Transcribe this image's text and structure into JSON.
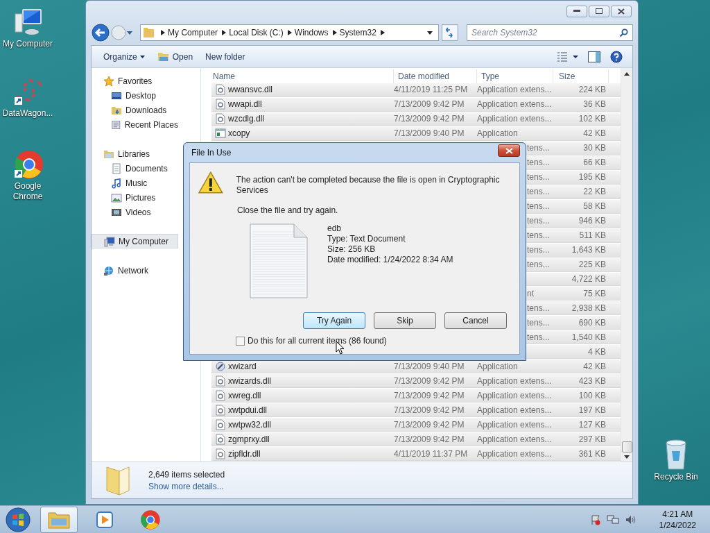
{
  "desktop_icons": [
    {
      "label": "My Computer",
      "kind": "computer"
    },
    {
      "label": "DataWagon...",
      "kind": "dots"
    },
    {
      "label": "Google Chrome",
      "kind": "chrome"
    },
    {
      "label": "Recycle Bin",
      "kind": "bin"
    }
  ],
  "explorer": {
    "address": [
      "My Computer",
      "Local Disk (C:)",
      "Windows",
      "System32"
    ],
    "search": {
      "placeholder": "Search System32"
    },
    "toolbar": [
      {
        "label": "Organize",
        "kind": "menu"
      },
      {
        "label": "Open",
        "kind": "open"
      },
      {
        "label": "New folder",
        "kind": "plain"
      }
    ],
    "nav": [
      {
        "label": "Favorites",
        "kind": "favorites",
        "selected": false,
        "children": [
          {
            "label": "Desktop",
            "kind": "desktop",
            "selected": false
          },
          {
            "label": "Downloads",
            "kind": "downloads",
            "selected": false
          },
          {
            "label": "Recent Places",
            "kind": "recent",
            "selected": false
          }
        ]
      },
      {
        "label": "Libraries",
        "kind": "libraries",
        "selected": false,
        "children": [
          {
            "label": "Documents",
            "kind": "documents",
            "selected": false
          },
          {
            "label": "Music",
            "kind": "music",
            "selected": false
          },
          {
            "label": "Pictures",
            "kind": "pictures",
            "selected": false
          },
          {
            "label": "Videos",
            "kind": "videos",
            "selected": false
          }
        ]
      },
      {
        "label": "My Computer",
        "kind": "computer",
        "selected": true
      },
      {
        "label": "Network",
        "kind": "network",
        "selected": false
      }
    ],
    "columns": [
      "Name",
      "Date modified",
      "Type",
      "Size"
    ],
    "rows": [
      {
        "kind": "dll",
        "name": "wwansvc.dll",
        "date": "4/11/2019 11:25 PM",
        "type": "Application extens...",
        "size": "224 KB",
        "selected": true
      },
      {
        "kind": "dll",
        "name": "wwapi.dll",
        "date": "7/13/2009 9:42 PM",
        "type": "Application extens...",
        "size": "36 KB",
        "selected": true
      },
      {
        "kind": "dll",
        "name": "wzcdlg.dll",
        "date": "7/13/2009 9:42 PM",
        "type": "Application extens...",
        "size": "102 KB",
        "selected": true
      },
      {
        "kind": "exe",
        "name": "xcopy",
        "date": "7/13/2009 9:40 PM",
        "type": "Application",
        "size": "42 KB",
        "selected": true
      },
      {
        "kind": "partial",
        "type": "tens...",
        "size": "30 KB",
        "selected": true
      },
      {
        "kind": "partial",
        "type": "tens...",
        "size": "66 KB",
        "selected": true
      },
      {
        "kind": "partial",
        "type": "tens...",
        "size": "195 KB",
        "selected": true
      },
      {
        "kind": "partial",
        "type": "tens...",
        "size": "22 KB",
        "selected": true
      },
      {
        "kind": "partial",
        "type": "tens...",
        "size": "58 KB",
        "selected": true
      },
      {
        "kind": "partial",
        "type": "tens...",
        "size": "946 KB",
        "selected": true
      },
      {
        "kind": "partial",
        "type": "tens...",
        "size": "511 KB",
        "selected": true
      },
      {
        "kind": "partial",
        "type": "tens...",
        "size": "1,643 KB",
        "selected": true
      },
      {
        "kind": "partial",
        "type": "tens...",
        "size": "225 KB",
        "selected": true
      },
      {
        "kind": "partial",
        "size": "4,722 KB",
        "selected": true
      },
      {
        "kind": "partial",
        "type": "nt",
        "size": "75 KB",
        "selected": true
      },
      {
        "kind": "partial",
        "type": "tens...",
        "size": "2,938 KB",
        "selected": true
      },
      {
        "kind": "partial",
        "type": "tens...",
        "size": "690 KB",
        "selected": true
      },
      {
        "kind": "partial",
        "type": "tens...",
        "size": "1,540 KB",
        "selected": true
      },
      {
        "kind": "partial",
        "size": "4 KB",
        "selected": true
      },
      {
        "kind": "wizard",
        "name": "xwizard",
        "date": "7/13/2009 9:40 PM",
        "type": "Application",
        "size": "42 KB",
        "selected": true
      },
      {
        "kind": "dll",
        "name": "xwizards.dll",
        "date": "7/13/2009 9:42 PM",
        "type": "Application extens...",
        "size": "423 KB",
        "selected": true
      },
      {
        "kind": "dll",
        "name": "xwreg.dll",
        "date": "7/13/2009 9:42 PM",
        "type": "Application extens...",
        "size": "100 KB",
        "selected": true
      },
      {
        "kind": "dll",
        "name": "xwtpdui.dll",
        "date": "7/13/2009 9:42 PM",
        "type": "Application extens...",
        "size": "197 KB",
        "selected": true
      },
      {
        "kind": "dll",
        "name": "xwtpw32.dll",
        "date": "7/13/2009 9:42 PM",
        "type": "Application extens...",
        "size": "127 KB",
        "selected": true
      },
      {
        "kind": "dll",
        "name": "zgmprxy.dll",
        "date": "7/13/2009 9:42 PM",
        "type": "Application extens...",
        "size": "297 KB",
        "selected": true
      },
      {
        "kind": "dll",
        "name": "zipfldr.dll",
        "date": "4/11/2019 11:37 PM",
        "type": "Application extens...",
        "size": "361 KB",
        "selected": true
      }
    ],
    "details": {
      "count": "2,649 items selected",
      "link": "Show more details..."
    }
  },
  "dialog": {
    "title": "File In Use",
    "message": "The action can't be completed because the file is open in Cryptographic Services",
    "instruction": "Close the file and try again.",
    "file": {
      "name": "edb",
      "lines": [
        "Type: Text Document",
        "Size: 256 KB",
        "Date modified: 1/24/2022 8:34 AM"
      ]
    },
    "buttons": [
      {
        "label": "Try Again",
        "default": true
      },
      {
        "label": "Skip",
        "default": false
      },
      {
        "label": "Cancel",
        "default": false
      }
    ],
    "checkbox": {
      "label": "Do this for all current items (86 found)",
      "checked": false
    }
  },
  "taskbar": {
    "apps": [
      {
        "kind": "explorer",
        "selected": true
      },
      {
        "kind": "media",
        "selected": false
      },
      {
        "kind": "chrome",
        "selected": false
      }
    ],
    "time": "4:21 AM",
    "date": "1/24/2022"
  }
}
